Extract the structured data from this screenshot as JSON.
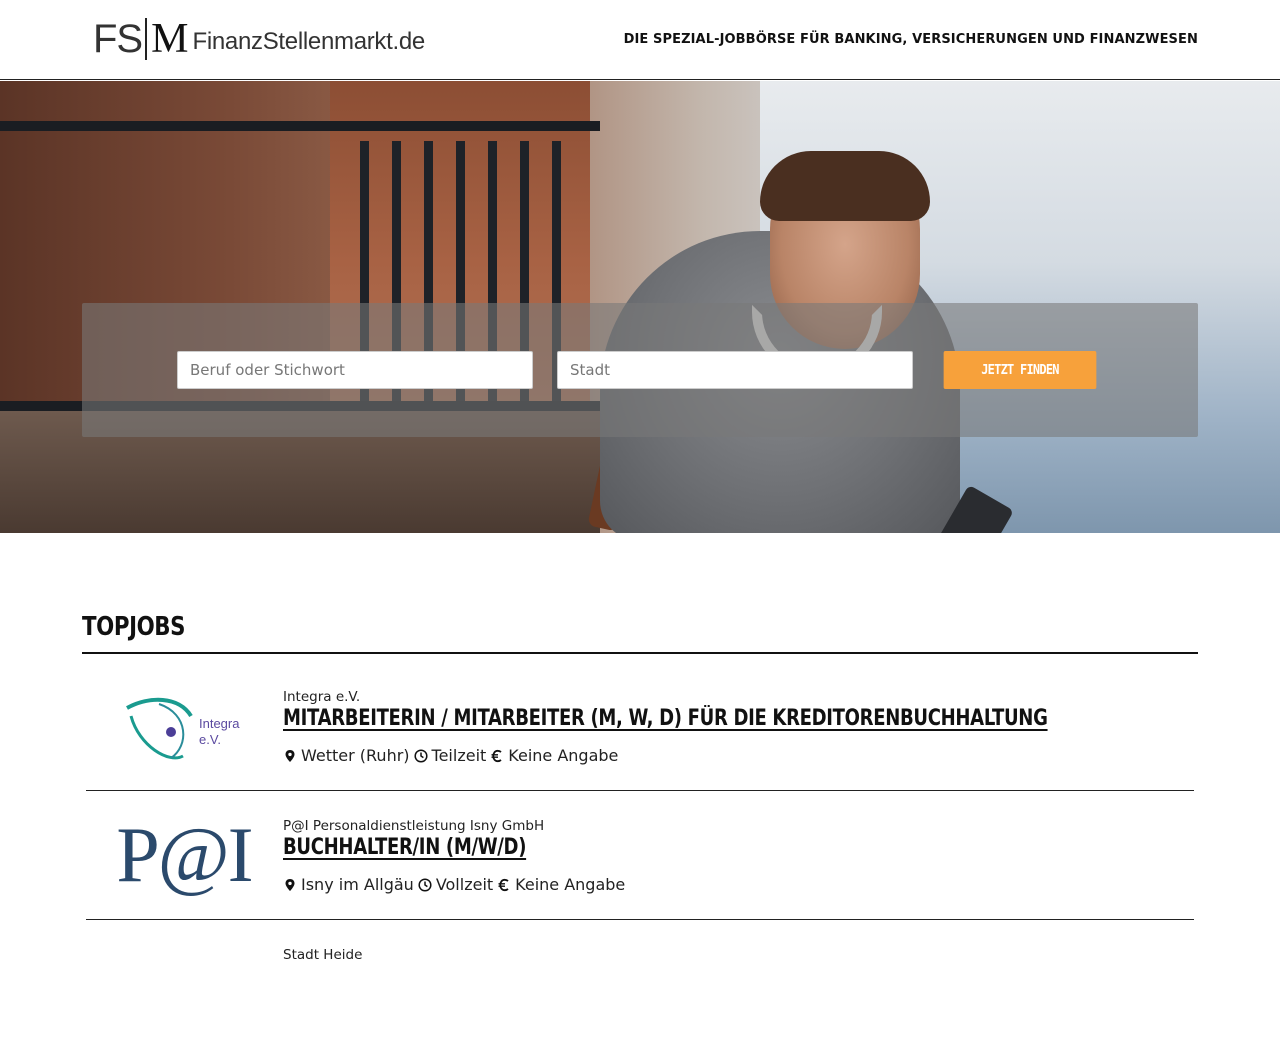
{
  "header": {
    "logo": {
      "fs": "FS",
      "m": "M",
      "text": "FinanzStellenmarkt.de"
    },
    "tagline": "DIE SPEZIAL-JOBBÖRSE FÜR BANKING, VERSICHERUNGEN UND FINANZWESEN"
  },
  "search": {
    "keyword_placeholder": "Beruf oder Stichwort",
    "keyword_value": "",
    "city_placeholder": "Stadt",
    "city_value": "",
    "button_label": "JETZT FINDEN",
    "button_color": "#f7a13b"
  },
  "topjobs": {
    "title": "TOPJOBS",
    "jobs": [
      {
        "company": "Integra e.V.",
        "logo_text": [
          "Integra",
          "e.V."
        ],
        "title": "MITARBEITERIN / MITARBEITER (M, W, D) FÜR DIE KREDITORENBUCHHALTUNG",
        "location": "Wetter (Ruhr)",
        "type": "Teilzeit",
        "salary": "Keine Angabe"
      },
      {
        "company": "P@I Personaldienstleistung Isny GmbH",
        "logo_text": "P@I",
        "title": "BUCHHALTER/IN (M/W/D)",
        "location": "Isny im Allgäu",
        "type": "Vollzeit",
        "salary": "Keine Angabe"
      },
      {
        "company": "Stadt Heide"
      }
    ]
  },
  "icons": [
    "map-marker-icon",
    "clock-icon",
    "euro-icon"
  ]
}
